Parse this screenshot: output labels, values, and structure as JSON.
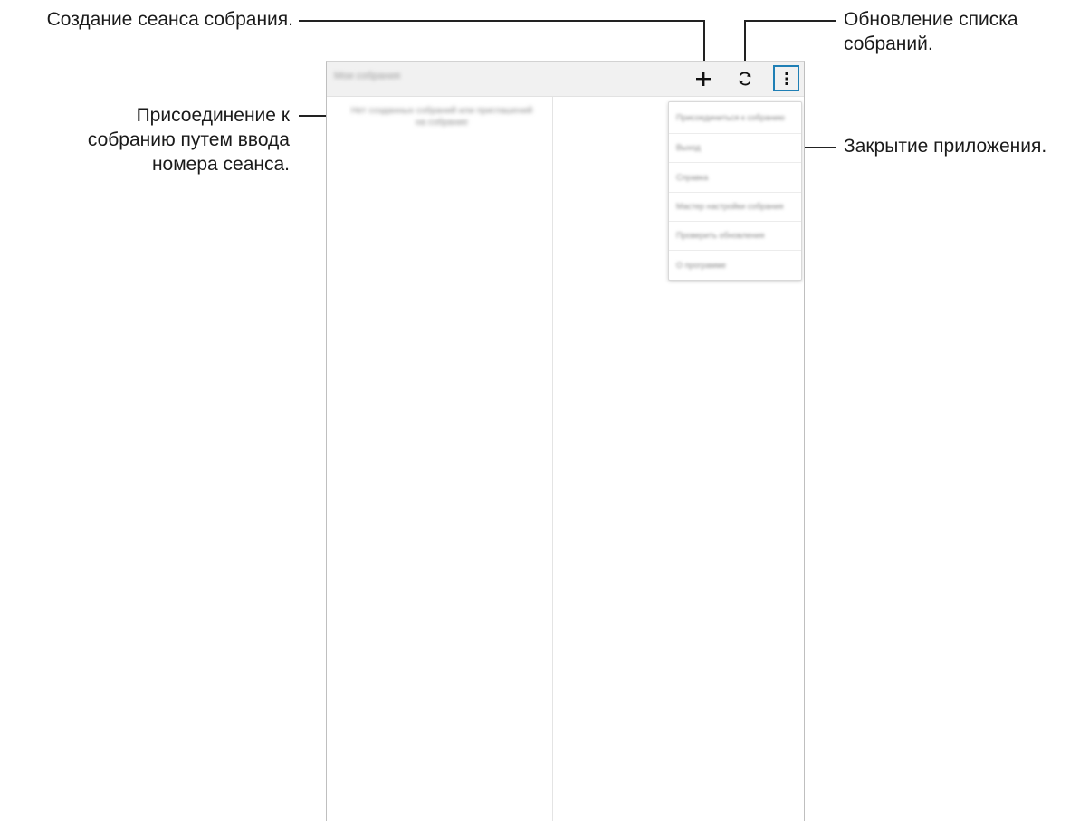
{
  "callouts": {
    "create_session": "Создание сеанса собрания.",
    "refresh_list_line1": "Обновление списка",
    "refresh_list_line2": "собраний.",
    "join_line1": "Присоединение к",
    "join_line2": "собранию путем ввода",
    "join_line3": "номера сеанса.",
    "close_app": "Закрытие приложения."
  },
  "appbar": {
    "title": "Мои собрания",
    "icons": [
      "plus-icon",
      "refresh-icon",
      "more-vert-icon"
    ]
  },
  "content": {
    "empty_message": "Нет созданных собраний или приглашений на собрание"
  },
  "menu": {
    "items": [
      "Присоединиться к собранию",
      "Выход",
      "Справка",
      "Мастер настройки собрания",
      "Проверить обновления",
      "О программе"
    ]
  },
  "colors": {
    "highlight": "#1f7fb5",
    "appbar_bg": "#f1f1f1"
  }
}
